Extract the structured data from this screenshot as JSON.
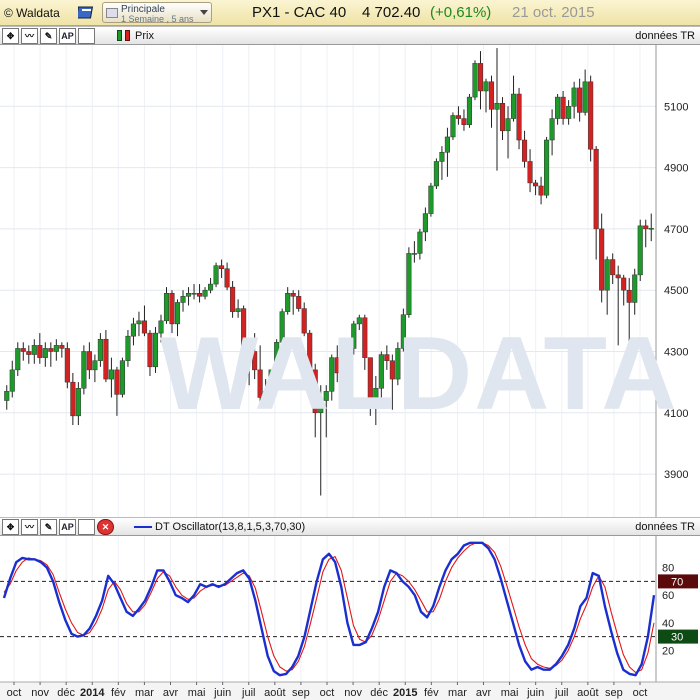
{
  "header": {
    "brand": "© Waldata",
    "preset_name": "Principale",
    "preset_detail": "1 Semaine , 5 ans",
    "symbol": "PX1 - CAC 40",
    "last": "4 702.40",
    "change": "(+0,61%)",
    "date": "21 oct. 2015",
    "icons": [
      "book-icon",
      "dropdown-icon"
    ]
  },
  "price_panel": {
    "legend": "Prix",
    "source": "données TR",
    "watermark": "WALDATA",
    "icons": [
      "crosshair-icon",
      "indicator-icon",
      "draw-icon",
      "ap-icon",
      "blank-icon"
    ]
  },
  "osc_panel": {
    "legend": "DT Oscillator(13,8,1,5,3,70,30)",
    "source": "données TR",
    "level_high": "70",
    "level_low": "30",
    "icons": [
      "crosshair-icon",
      "indicator-icon",
      "draw-icon",
      "ap-icon",
      "blank-icon",
      "close-icon"
    ]
  },
  "colors": {
    "up": "#1e9a2a",
    "down": "#d22222",
    "osc_fast": "#1a2fd0",
    "osc_slow": "#e01818",
    "high_bg": "#5a0a0a",
    "low_bg": "#0d4a14"
  },
  "chart_data": [
    {
      "type": "candlestick",
      "title": "PX1 - CAC 40",
      "y_ticks": [
        3900,
        4100,
        4300,
        4500,
        4700,
        4900,
        5100
      ],
      "ylim": [
        3760,
        5300
      ],
      "x_ticks": [
        "oct",
        "nov",
        "déc",
        "2014",
        "fév",
        "mar",
        "avr",
        "mai",
        "juin",
        "juil",
        "août",
        "sep",
        "oct",
        "nov",
        "déc",
        "2015",
        "fév",
        "mar",
        "avr",
        "mai",
        "juin",
        "juil",
        "août",
        "sep",
        "oct"
      ],
      "candles": [
        [
          4140,
          4190,
          4110,
          4170
        ],
        [
          4170,
          4270,
          4150,
          4240
        ],
        [
          4240,
          4330,
          4220,
          4310
        ],
        [
          4310,
          4330,
          4270,
          4300
        ],
        [
          4300,
          4320,
          4260,
          4290
        ],
        [
          4290,
          4340,
          4260,
          4320
        ],
        [
          4320,
          4360,
          4260,
          4280
        ],
        [
          4280,
          4330,
          4250,
          4310
        ],
        [
          4310,
          4330,
          4250,
          4300
        ],
        [
          4300,
          4340,
          4270,
          4320
        ],
        [
          4320,
          4330,
          4280,
          4310
        ],
        [
          4310,
          4330,
          4180,
          4200
        ],
        [
          4200,
          4230,
          4060,
          4090
        ],
        [
          4090,
          4200,
          4060,
          4180
        ],
        [
          4180,
          4320,
          4160,
          4300
        ],
        [
          4300,
          4330,
          4210,
          4240
        ],
        [
          4240,
          4290,
          4200,
          4270
        ],
        [
          4270,
          4360,
          4250,
          4340
        ],
        [
          4340,
          4370,
          4200,
          4210
        ],
        [
          4210,
          4280,
          4150,
          4240
        ],
        [
          4240,
          4250,
          4090,
          4160
        ],
        [
          4160,
          4280,
          4150,
          4270
        ],
        [
          4270,
          4370,
          4250,
          4350
        ],
        [
          4350,
          4410,
          4320,
          4390
        ],
        [
          4390,
          4430,
          4350,
          4400
        ],
        [
          4400,
          4450,
          4350,
          4360
        ],
        [
          4360,
          4370,
          4220,
          4250
        ],
        [
          4250,
          4380,
          4230,
          4360
        ],
        [
          4360,
          4420,
          4330,
          4400
        ],
        [
          4400,
          4510,
          4390,
          4490
        ],
        [
          4490,
          4500,
          4360,
          4390
        ],
        [
          4390,
          4470,
          4350,
          4460
        ],
        [
          4460,
          4500,
          4430,
          4480
        ],
        [
          4480,
          4510,
          4450,
          4490
        ],
        [
          4490,
          4520,
          4470,
          4490
        ],
        [
          4490,
          4520,
          4460,
          4480
        ],
        [
          4480,
          4510,
          4470,
          4500
        ],
        [
          4500,
          4540,
          4490,
          4520
        ],
        [
          4520,
          4590,
          4510,
          4580
        ],
        [
          4580,
          4600,
          4540,
          4570
        ],
        [
          4570,
          4590,
          4500,
          4510
        ],
        [
          4510,
          4530,
          4410,
          4430
        ],
        [
          4430,
          4470,
          4410,
          4440
        ],
        [
          4440,
          4450,
          4290,
          4320
        ],
        [
          4320,
          4340,
          4190,
          4300
        ],
        [
          4300,
          4360,
          4210,
          4240
        ],
        [
          4240,
          4320,
          4120,
          4150
        ],
        [
          4150,
          4210,
          4130,
          4170
        ],
        [
          4170,
          4240,
          4160,
          4240
        ],
        [
          4240,
          4340,
          4230,
          4330
        ],
        [
          4330,
          4440,
          4320,
          4430
        ],
        [
          4430,
          4510,
          4420,
          4490
        ],
        [
          4490,
          4500,
          4420,
          4480
        ],
        [
          4480,
          4500,
          4430,
          4440
        ],
        [
          4440,
          4460,
          4350,
          4360
        ],
        [
          4360,
          4370,
          4180,
          4240
        ],
        [
          4240,
          4260,
          4020,
          4100
        ],
        [
          4100,
          4190,
          3830,
          4140
        ],
        [
          4140,
          4190,
          4020,
          4170
        ],
        [
          4170,
          4290,
          4140,
          4280
        ],
        [
          4280,
          4320,
          4200,
          4230
        ],
        [
          4230,
          4240,
          4170,
          4200
        ],
        [
          4200,
          4320,
          4190,
          4310
        ],
        [
          4310,
          4400,
          4290,
          4390
        ],
        [
          4390,
          4420,
          4370,
          4410
        ],
        [
          4410,
          4420,
          4240,
          4280
        ],
        [
          4280,
          4280,
          4090,
          4120
        ],
        [
          4120,
          4220,
          4060,
          4180
        ],
        [
          4180,
          4300,
          4150,
          4290
        ],
        [
          4290,
          4320,
          4240,
          4270
        ],
        [
          4270,
          4290,
          4110,
          4210
        ],
        [
          4210,
          4330,
          4190,
          4310
        ],
        [
          4310,
          4440,
          4300,
          4420
        ],
        [
          4420,
          4640,
          4410,
          4620
        ],
        [
          4620,
          4660,
          4590,
          4620
        ],
        [
          4620,
          4700,
          4600,
          4690
        ],
        [
          4690,
          4770,
          4660,
          4750
        ],
        [
          4750,
          4850,
          4740,
          4840
        ],
        [
          4840,
          4930,
          4830,
          4920
        ],
        [
          4920,
          4970,
          4860,
          4950
        ],
        [
          4950,
          5030,
          4870,
          5000
        ],
        [
          5000,
          5080,
          4990,
          5070
        ],
        [
          5070,
          5100,
          5040,
          5060
        ],
        [
          5060,
          5090,
          5020,
          5040
        ],
        [
          5040,
          5140,
          5030,
          5130
        ],
        [
          5130,
          5250,
          5120,
          5240
        ],
        [
          5240,
          5280,
          5090,
          5150
        ],
        [
          5150,
          5190,
          5080,
          5180
        ],
        [
          5180,
          5200,
          5030,
          5090
        ],
        [
          5090,
          5290,
          4890,
          5110
        ],
        [
          5110,
          5130,
          4990,
          5020
        ],
        [
          5020,
          5100,
          4930,
          5060
        ],
        [
          5060,
          5200,
          5050,
          5140
        ],
        [
          5140,
          5160,
          4960,
          4990
        ],
        [
          4990,
          5020,
          4900,
          4920
        ],
        [
          4920,
          4960,
          4820,
          4850
        ],
        [
          4850,
          4860,
          4810,
          4840
        ],
        [
          4840,
          4870,
          4780,
          4810
        ],
        [
          4810,
          5000,
          4800,
          4990
        ],
        [
          4990,
          5090,
          4940,
          5060
        ],
        [
          5060,
          5140,
          5040,
          5130
        ],
        [
          5130,
          5150,
          5040,
          5060
        ],
        [
          5060,
          5120,
          5040,
          5100
        ],
        [
          5100,
          5180,
          5060,
          5160
        ],
        [
          5160,
          5190,
          5050,
          5080
        ],
        [
          5080,
          5220,
          5070,
          5180
        ],
        [
          5180,
          5200,
          4920,
          4960
        ],
        [
          4960,
          4970,
          4600,
          4700
        ],
        [
          4700,
          4750,
          4460,
          4500
        ],
        [
          4500,
          4610,
          4420,
          4600
        ],
        [
          4600,
          4620,
          4520,
          4550
        ],
        [
          4550,
          4580,
          4320,
          4540
        ],
        [
          4540,
          4550,
          4450,
          4500
        ],
        [
          4500,
          4540,
          4280,
          4460
        ],
        [
          4460,
          4570,
          4420,
          4550
        ],
        [
          4550,
          4730,
          4530,
          4710
        ],
        [
          4710,
          4730,
          4640,
          4700
        ],
        [
          4700,
          4750,
          4660,
          4702
        ]
      ]
    },
    {
      "type": "line",
      "title": "DT Oscillator(13,8,1,5,3,70,30)",
      "y_ticks": [
        20,
        40,
        60,
        80
      ],
      "ylim": [
        0,
        100
      ],
      "levels": [
        70,
        30
      ],
      "series": [
        {
          "name": "DT Oscillator",
          "values": [
            58,
            72,
            84,
            87,
            86,
            86,
            84,
            80,
            70,
            55,
            42,
            32,
            30,
            31,
            36,
            45,
            56,
            74,
            68,
            58,
            48,
            45,
            50,
            56,
            66,
            78,
            78,
            70,
            60,
            58,
            55,
            60,
            68,
            66,
            68,
            66,
            68,
            72,
            76,
            78,
            72,
            56,
            36,
            16,
            5,
            2,
            3,
            8,
            16,
            30,
            50,
            70,
            86,
            90,
            84,
            66,
            40,
            24,
            24,
            26,
            36,
            48,
            66,
            78,
            76,
            70,
            66,
            60,
            48,
            44,
            52,
            66,
            78,
            86,
            90,
            96,
            98,
            98,
            98,
            94,
            86,
            72,
            56,
            40,
            24,
            12,
            6,
            8,
            6,
            6,
            10,
            16,
            24,
            36,
            52,
            58,
            76,
            74,
            52,
            34,
            18,
            6,
            3,
            2,
            10,
            30,
            60
          ]
        },
        {
          "name": "Signal",
          "values": [
            62,
            68,
            78,
            84,
            87,
            86,
            85,
            82,
            75,
            62,
            50,
            40,
            33,
            31,
            33,
            40,
            50,
            64,
            70,
            64,
            54,
            48,
            48,
            53,
            62,
            72,
            77,
            74,
            66,
            60,
            57,
            58,
            63,
            66,
            67,
            67,
            67,
            70,
            73,
            76,
            74,
            65,
            48,
            30,
            16,
            8,
            5,
            6,
            12,
            23,
            40,
            58,
            77,
            86,
            88,
            78,
            58,
            38,
            28,
            26,
            31,
            42,
            56,
            70,
            76,
            74,
            70,
            64,
            56,
            48,
            48,
            57,
            70,
            80,
            87,
            92,
            96,
            98,
            98,
            96,
            91,
            81,
            67,
            52,
            37,
            24,
            14,
            10,
            8,
            7,
            9,
            13,
            20,
            30,
            43,
            53,
            66,
            74,
            66,
            48,
            32,
            17,
            8,
            4,
            6,
            18,
            40
          ]
        }
      ]
    }
  ]
}
